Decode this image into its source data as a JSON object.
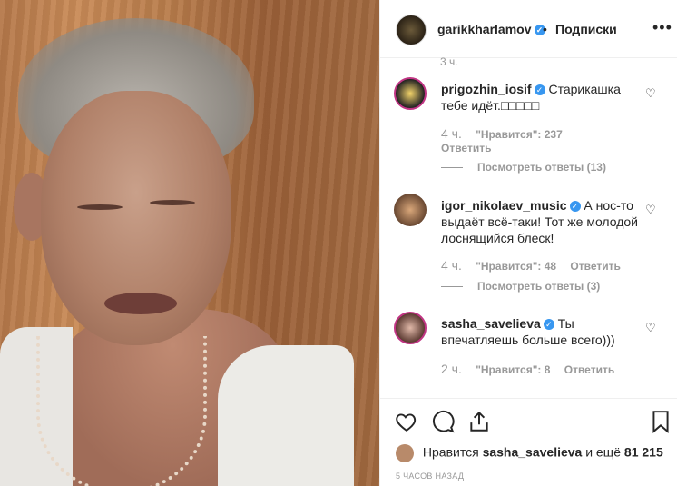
{
  "header": {
    "username": "garikkharlamov",
    "follow_label": "Подписки",
    "separator": "•",
    "more_icon": "more-options-icon"
  },
  "scroll_partial_time": "3 ч.",
  "comments": [
    {
      "username": "prigozhin_iosif",
      "text": "Старикашка тебе идёт.□□□□□",
      "time": "4 ч.",
      "likes": "\"Нравится\": 237",
      "reply": "Ответить",
      "view_replies": "Посмотреть ответы (13)"
    },
    {
      "username": "igor_nikolaev_music",
      "text": "А нос-то выдаёт всё-таки! Тот же молодой лоснящийся блеск!",
      "time": "4 ч.",
      "likes": "\"Нравится\": 48",
      "reply": "Ответить",
      "view_replies": "Посмотреть ответы (3)"
    },
    {
      "username": "sasha_savelieva",
      "text": "Ты впечатляешь больше всего)))",
      "time": "2 ч.",
      "likes": "\"Нравится\": 8",
      "reply": "Ответить"
    }
  ],
  "footer": {
    "liked_prefix": "Нравится",
    "liked_user": "sasha_savelieva",
    "liked_suffix": "и ещё",
    "liked_count": "81 215",
    "time_ago": "5 ЧАСОВ НАЗАД"
  },
  "colors": {
    "verified": "#3897f0",
    "muted": "#999999",
    "text": "#262626"
  }
}
